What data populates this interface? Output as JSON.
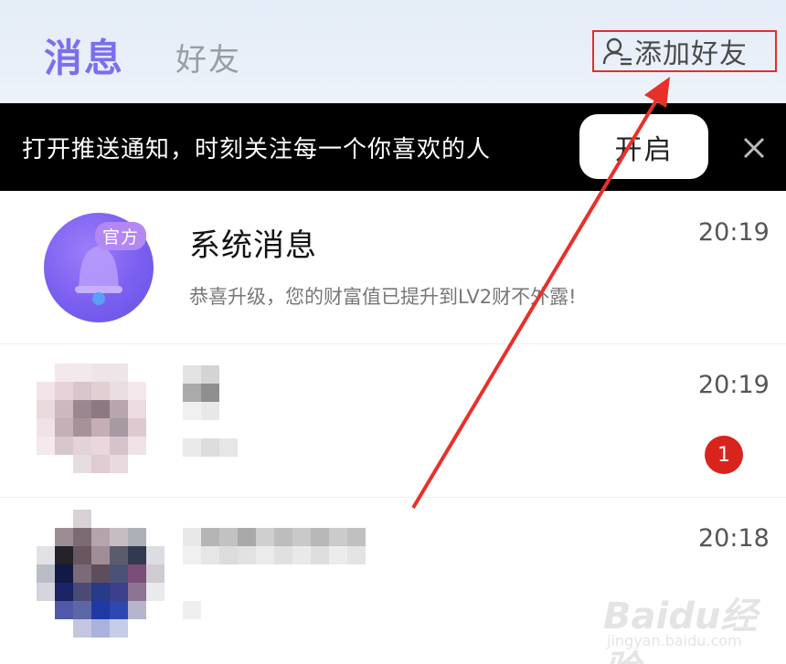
{
  "header": {
    "tab_messages": "消息",
    "tab_friends": "好友",
    "add_friend": "添加好友",
    "accent_color": "#7b6ff0"
  },
  "notice": {
    "text": "打开推送通知，时刻关注每一个你喜欢的人",
    "button": "开启",
    "close_icon": "close-icon"
  },
  "conversations": [
    {
      "title": "系统消息",
      "badge": "官方",
      "preview": "恭喜升级，您的财富值已提升到LV2财不外露!",
      "time": "20:19",
      "avatar_icon": "bell-icon"
    },
    {
      "title": "",
      "preview": "",
      "time": "20:19",
      "unread": "1"
    },
    {
      "title": "",
      "preview": "",
      "time": "20:18"
    }
  ],
  "watermark": {
    "main": "Baidu经验",
    "sub": "jingyan.baidu.com"
  }
}
